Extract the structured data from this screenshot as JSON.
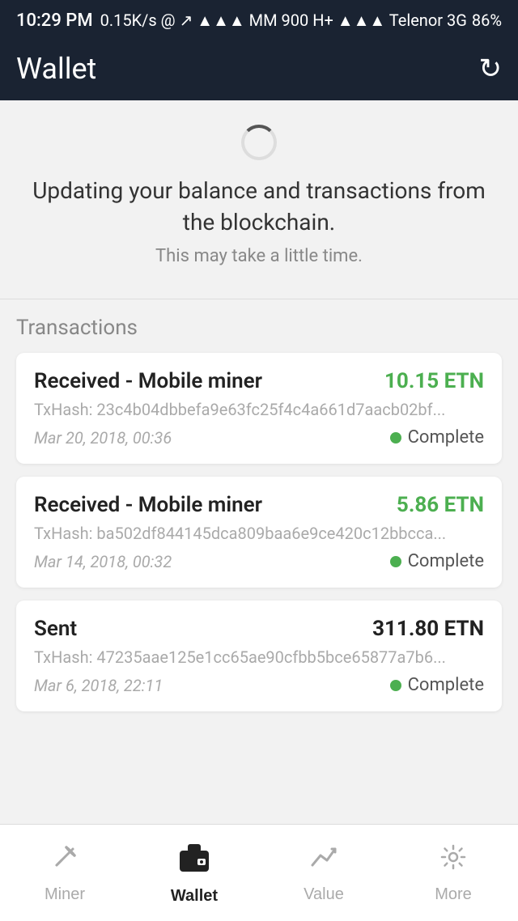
{
  "status_bar": {
    "time": "10:29 PM",
    "network_info": "0.15K/s  @  ↗  ▲▲▲  MM 900 H+  ▲▲▲  Telenor 3G",
    "battery": "86%"
  },
  "header": {
    "title": "Wallet",
    "refresh_icon": "refresh-icon"
  },
  "sync": {
    "message_line1": "Updating your balance and transactions from",
    "message_line2": "the blockchain.",
    "message_sub": "This may take a little time."
  },
  "transactions": {
    "label": "Transactions",
    "items": [
      {
        "type": "Received - Mobile miner",
        "amount": "10.15 ETN",
        "amount_type": "green",
        "txhash": "TxHash: 23c4b04dbbefa9e63fc25f4c4a661d7aacb02bf...",
        "date": "Mar 20, 2018, 00:36",
        "status": "Complete"
      },
      {
        "type": "Received - Mobile miner",
        "amount": "5.86 ETN",
        "amount_type": "green",
        "txhash": "TxHash: ba502df844145dca809baa6e9ce420c12bbcca...",
        "date": "Mar 14, 2018, 00:32",
        "status": "Complete"
      },
      {
        "type": "Sent",
        "amount": "311.80 ETN",
        "amount_type": "dark",
        "txhash": "TxHash: 47235aae125e1cc65ae90cfbb5bce65877a7b6...",
        "date": "Mar 6, 2018, 22:11",
        "status": "Complete"
      }
    ]
  },
  "bottom_nav": {
    "items": [
      {
        "label": "Miner",
        "icon": "pickaxe-icon",
        "active": false
      },
      {
        "label": "Wallet",
        "icon": "wallet-icon",
        "active": true
      },
      {
        "label": "Value",
        "icon": "chart-icon",
        "active": false
      },
      {
        "label": "More",
        "icon": "gear-icon",
        "active": false
      }
    ]
  }
}
